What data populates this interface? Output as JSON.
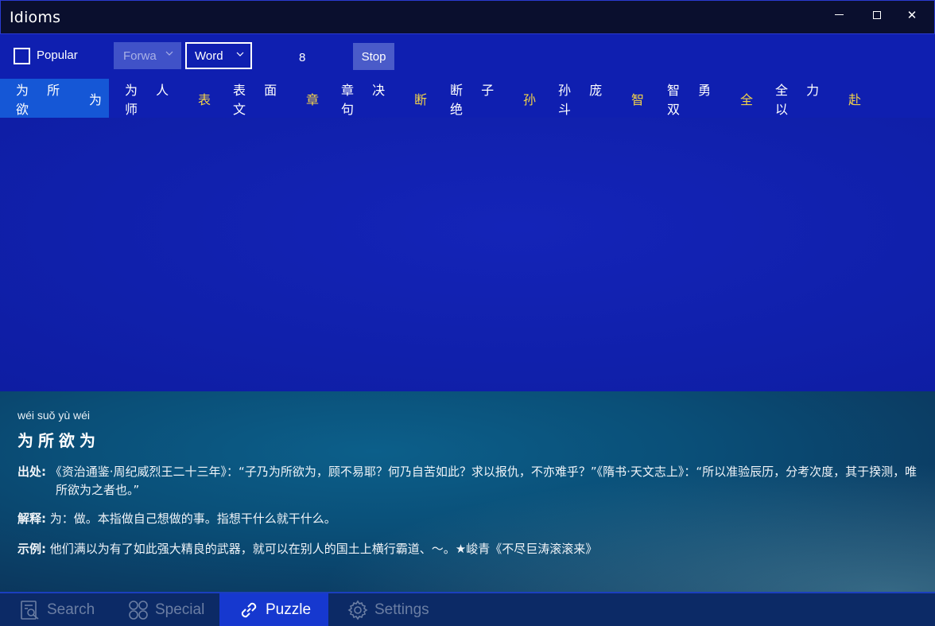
{
  "window": {
    "title": "Idioms",
    "minimize_icon": "minimize-icon",
    "maximize_icon": "maximize-icon",
    "close_icon": "close-icon",
    "close_glyph": "✕"
  },
  "toolbar": {
    "popular_label": "Popular",
    "popular_checked": false,
    "direction_value": "Forwa",
    "mode_value": "Word",
    "count": "8",
    "stop_label": "Stop"
  },
  "idioms": [
    {
      "head": "为 所 欲 ",
      "last": "为",
      "active": true
    },
    {
      "head": "为 人 师 ",
      "last": "表",
      "active": false
    },
    {
      "head": "表 面 文 ",
      "last": "章",
      "active": false
    },
    {
      "head": "章 决 句 ",
      "last": "断",
      "active": false
    },
    {
      "head": "断 子 绝 ",
      "last": "孙",
      "active": false
    },
    {
      "head": "孙 庞 斗 ",
      "last": "智",
      "active": false
    },
    {
      "head": "智 勇 双 ",
      "last": "全",
      "active": false
    },
    {
      "head": "全 力 以 ",
      "last": "赴",
      "active": false
    }
  ],
  "detail": {
    "pinyin": "wéi suǒ yù wéi",
    "title": "为所欲为",
    "source_label": "出处:",
    "source_text": "《资治通鉴·周纪威烈王二十三年》：“子乃为所欲为，顾不易耶？何乃自苦如此？求以报仇，不亦难乎？”《隋书·天文志上》：“所以准验辰历，分考次度，其于揆测，唯所欲为之者也。”",
    "meaning_label": "解释:",
    "meaning_text": "为：做。本指做自己想做的事。指想干什么就干什么。",
    "example_label": "示例:",
    "example_text": "他们满以为有了如此强大精良的武器，就可以在别人的国土上横行霸道、～。★峻青《不尽巨涛滚滚来》"
  },
  "nav": [
    {
      "label": "Search",
      "icon": "search-icon",
      "active": false
    },
    {
      "label": "Special",
      "icon": "special-icon",
      "active": false
    },
    {
      "label": "Puzzle",
      "icon": "link-icon",
      "active": true
    },
    {
      "label": "Settings",
      "icon": "gear-icon",
      "active": false
    }
  ],
  "colors": {
    "background": "#0f1fb0",
    "title_bar": "#0a0f2e",
    "active_tab": "#1557d6",
    "highlight_char": "#f2d24a",
    "nav_active": "#1638cf"
  }
}
